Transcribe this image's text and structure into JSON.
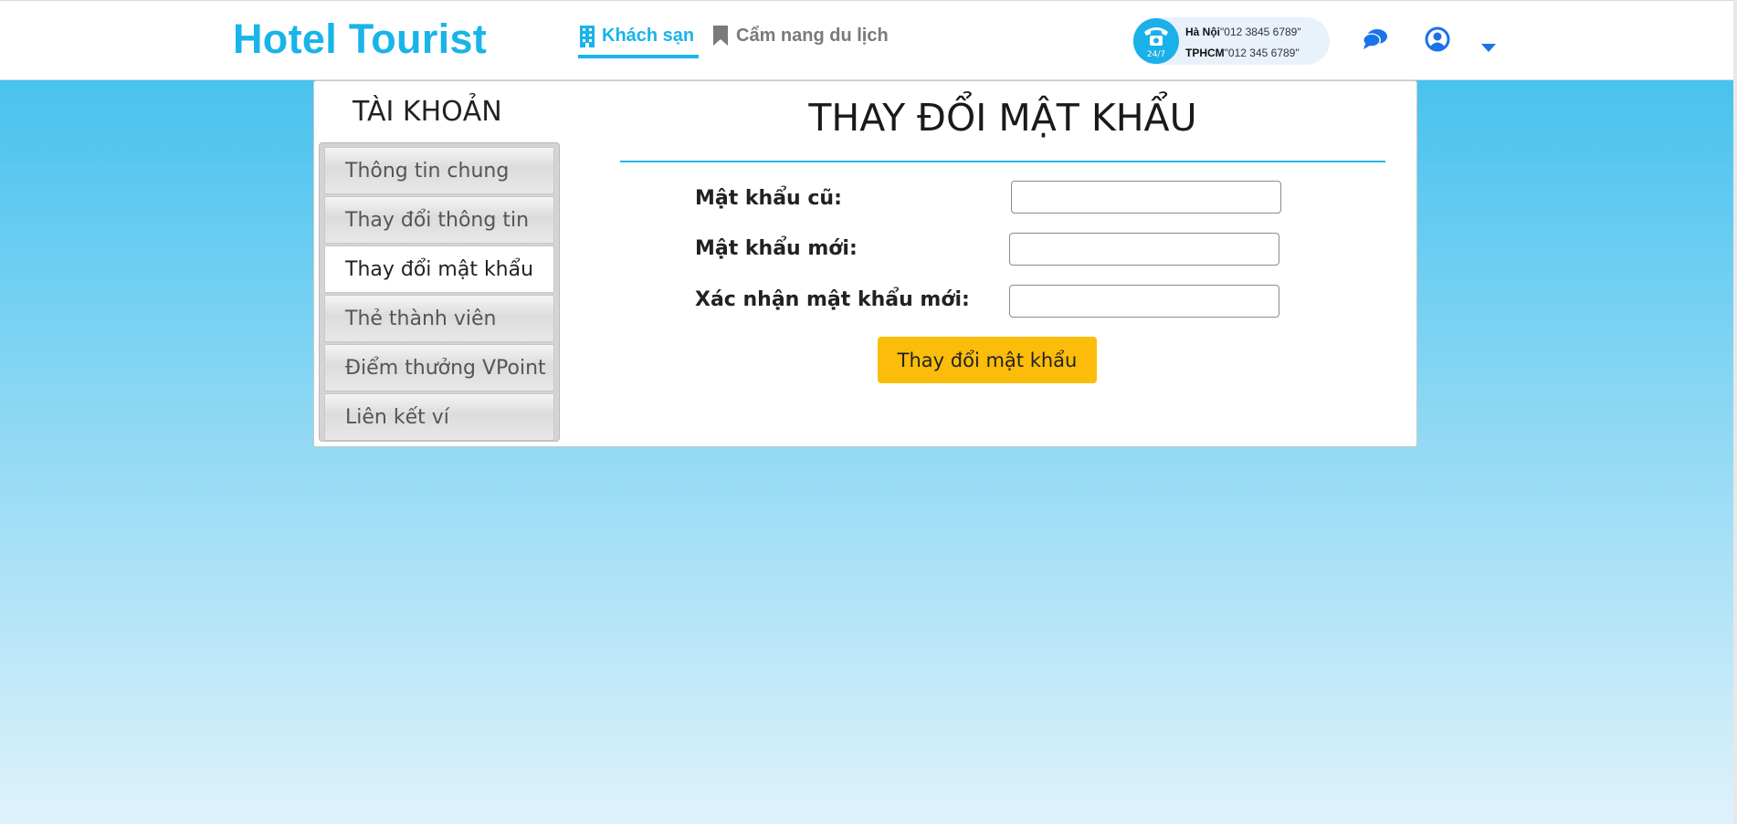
{
  "header": {
    "logo": "Hotel Tourist",
    "nav": [
      {
        "label": "Khách sạn",
        "icon": "building-icon",
        "active": true
      },
      {
        "label": "Cẩm nang du lịch",
        "icon": "bookmark-icon",
        "active": false
      }
    ],
    "hotline": {
      "badge": "24/7",
      "lines": [
        {
          "city": "Hà Nội",
          "phone": "\"012 3845 6789\""
        },
        {
          "city": "TPHCM",
          "phone": "\"012 345 6789\""
        }
      ]
    },
    "icons": [
      "chat-icon",
      "user-icon",
      "caret-down-icon"
    ]
  },
  "sidebar": {
    "title": "TÀI KHOẢN",
    "items": [
      {
        "label": "Thông tin chung",
        "active": false
      },
      {
        "label": "Thay đổi thông tin",
        "active": false
      },
      {
        "label": "Thay đổi mật khẩu",
        "active": true
      },
      {
        "label": "Thẻ thành viên",
        "active": false
      },
      {
        "label": "Điểm thưởng VPoint",
        "active": false
      },
      {
        "label": "Liên kết ví",
        "active": false
      }
    ]
  },
  "form": {
    "title": "THAY ĐỔI MẬT KHẨU",
    "fields": [
      {
        "label": "Mật khẩu cũ:",
        "value": ""
      },
      {
        "label": "Mật khẩu mới:",
        "value": ""
      },
      {
        "label": "Xác nhận mật khẩu mới:",
        "value": ""
      }
    ],
    "submit_label": "Thay đổi mật khẩu"
  },
  "colors": {
    "brand": "#18b4ea",
    "button": "#fbbd0a",
    "icon_blue": "#1a73e8"
  }
}
